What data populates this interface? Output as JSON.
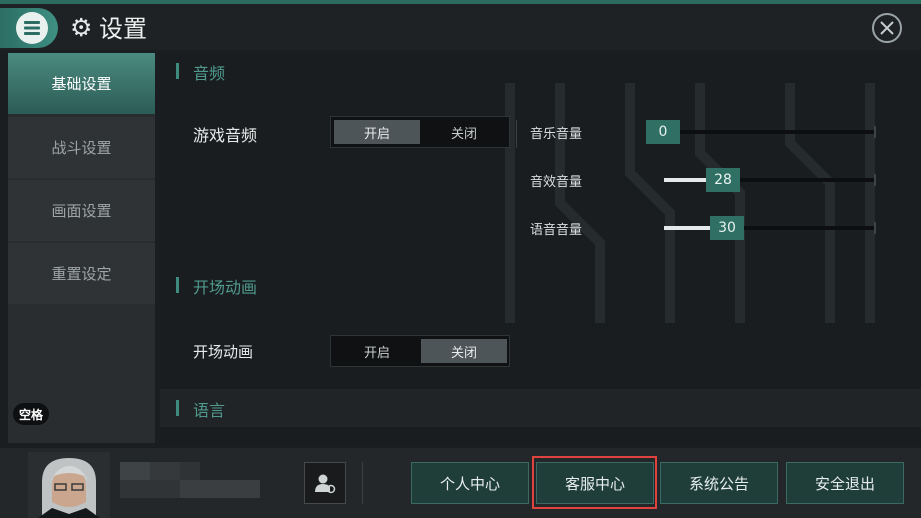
{
  "header": {
    "title": "设置",
    "menu_icon": "menu-list-icon",
    "settings_icon": "gear-icon",
    "close_icon": "close-icon"
  },
  "sidebar": {
    "items": [
      {
        "label": "基础设置",
        "active": true
      },
      {
        "label": "战斗设置",
        "active": false
      },
      {
        "label": "画面设置",
        "active": false
      },
      {
        "label": "重置设定",
        "active": false
      }
    ],
    "key_hint": "空格"
  },
  "sections": {
    "audio": {
      "title": "音频",
      "game_audio_label": "游戏音频",
      "toggle": {
        "on": "开启",
        "off": "关闭",
        "selected": "开启"
      },
      "volumes": [
        {
          "label": "音乐音量",
          "value": "0",
          "max": 100
        },
        {
          "label": "音效音量",
          "value": "28",
          "max": 100
        },
        {
          "label": "语音音量",
          "value": "30",
          "max": 100
        }
      ]
    },
    "opening": {
      "title": "开场动画",
      "label": "开场动画",
      "toggle": {
        "on": "开启",
        "off": "关闭",
        "selected": "关闭"
      }
    },
    "language": {
      "title": "语言"
    }
  },
  "footer": {
    "account_icon": "account-switch-icon",
    "buttons": [
      "个人中心",
      "客服中心",
      "系统公告",
      "安全退出"
    ],
    "highlighted": "客服中心"
  },
  "colors": {
    "accent": "#3f8a7e",
    "button_bg": "#1f3e3a",
    "highlight": "#e0423d",
    "knob": "#2f6f64"
  }
}
